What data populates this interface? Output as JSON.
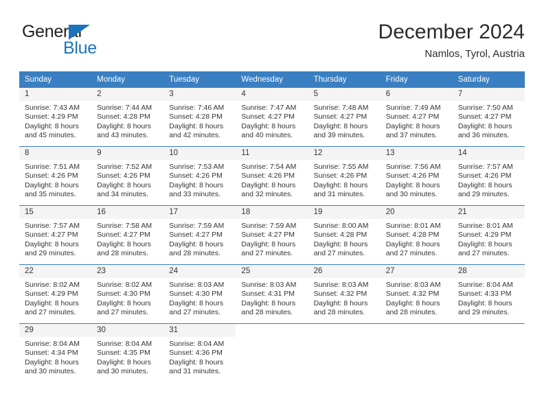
{
  "logo": {
    "primary_text": "General",
    "secondary_text": "Blue",
    "primary_color": "#231f20",
    "accent_color": "#1b74bd",
    "triangle_icon": "blue-triangle-icon"
  },
  "header": {
    "title": "December 2024",
    "subtitle": "Namlos, Tyrol, Austria"
  },
  "theme": {
    "header_bg": "#3a7fc1",
    "header_text": "#ffffff",
    "daynum_bg": "#f4f4f4",
    "cell_bg": "#ffffff",
    "text": "#333333",
    "grid_line": "#3a7fc1"
  },
  "weekday_headers": [
    "Sunday",
    "Monday",
    "Tuesday",
    "Wednesday",
    "Thursday",
    "Friday",
    "Saturday"
  ],
  "weeks": [
    [
      {
        "day": "1",
        "sunrise": "Sunrise: 7:43 AM",
        "sunset": "Sunset: 4:29 PM",
        "daylight_line1": "Daylight: 8 hours",
        "daylight_line2": "and 45 minutes."
      },
      {
        "day": "2",
        "sunrise": "Sunrise: 7:44 AM",
        "sunset": "Sunset: 4:28 PM",
        "daylight_line1": "Daylight: 8 hours",
        "daylight_line2": "and 43 minutes."
      },
      {
        "day": "3",
        "sunrise": "Sunrise: 7:46 AM",
        "sunset": "Sunset: 4:28 PM",
        "daylight_line1": "Daylight: 8 hours",
        "daylight_line2": "and 42 minutes."
      },
      {
        "day": "4",
        "sunrise": "Sunrise: 7:47 AM",
        "sunset": "Sunset: 4:27 PM",
        "daylight_line1": "Daylight: 8 hours",
        "daylight_line2": "and 40 minutes."
      },
      {
        "day": "5",
        "sunrise": "Sunrise: 7:48 AM",
        "sunset": "Sunset: 4:27 PM",
        "daylight_line1": "Daylight: 8 hours",
        "daylight_line2": "and 39 minutes."
      },
      {
        "day": "6",
        "sunrise": "Sunrise: 7:49 AM",
        "sunset": "Sunset: 4:27 PM",
        "daylight_line1": "Daylight: 8 hours",
        "daylight_line2": "and 37 minutes."
      },
      {
        "day": "7",
        "sunrise": "Sunrise: 7:50 AM",
        "sunset": "Sunset: 4:27 PM",
        "daylight_line1": "Daylight: 8 hours",
        "daylight_line2": "and 36 minutes."
      }
    ],
    [
      {
        "day": "8",
        "sunrise": "Sunrise: 7:51 AM",
        "sunset": "Sunset: 4:26 PM",
        "daylight_line1": "Daylight: 8 hours",
        "daylight_line2": "and 35 minutes."
      },
      {
        "day": "9",
        "sunrise": "Sunrise: 7:52 AM",
        "sunset": "Sunset: 4:26 PM",
        "daylight_line1": "Daylight: 8 hours",
        "daylight_line2": "and 34 minutes."
      },
      {
        "day": "10",
        "sunrise": "Sunrise: 7:53 AM",
        "sunset": "Sunset: 4:26 PM",
        "daylight_line1": "Daylight: 8 hours",
        "daylight_line2": "and 33 minutes."
      },
      {
        "day": "11",
        "sunrise": "Sunrise: 7:54 AM",
        "sunset": "Sunset: 4:26 PM",
        "daylight_line1": "Daylight: 8 hours",
        "daylight_line2": "and 32 minutes."
      },
      {
        "day": "12",
        "sunrise": "Sunrise: 7:55 AM",
        "sunset": "Sunset: 4:26 PM",
        "daylight_line1": "Daylight: 8 hours",
        "daylight_line2": "and 31 minutes."
      },
      {
        "day": "13",
        "sunrise": "Sunrise: 7:56 AM",
        "sunset": "Sunset: 4:26 PM",
        "daylight_line1": "Daylight: 8 hours",
        "daylight_line2": "and 30 minutes."
      },
      {
        "day": "14",
        "sunrise": "Sunrise: 7:57 AM",
        "sunset": "Sunset: 4:26 PM",
        "daylight_line1": "Daylight: 8 hours",
        "daylight_line2": "and 29 minutes."
      }
    ],
    [
      {
        "day": "15",
        "sunrise": "Sunrise: 7:57 AM",
        "sunset": "Sunset: 4:27 PM",
        "daylight_line1": "Daylight: 8 hours",
        "daylight_line2": "and 29 minutes."
      },
      {
        "day": "16",
        "sunrise": "Sunrise: 7:58 AM",
        "sunset": "Sunset: 4:27 PM",
        "daylight_line1": "Daylight: 8 hours",
        "daylight_line2": "and 28 minutes."
      },
      {
        "day": "17",
        "sunrise": "Sunrise: 7:59 AM",
        "sunset": "Sunset: 4:27 PM",
        "daylight_line1": "Daylight: 8 hours",
        "daylight_line2": "and 28 minutes."
      },
      {
        "day": "18",
        "sunrise": "Sunrise: 7:59 AM",
        "sunset": "Sunset: 4:27 PM",
        "daylight_line1": "Daylight: 8 hours",
        "daylight_line2": "and 27 minutes."
      },
      {
        "day": "19",
        "sunrise": "Sunrise: 8:00 AM",
        "sunset": "Sunset: 4:28 PM",
        "daylight_line1": "Daylight: 8 hours",
        "daylight_line2": "and 27 minutes."
      },
      {
        "day": "20",
        "sunrise": "Sunrise: 8:01 AM",
        "sunset": "Sunset: 4:28 PM",
        "daylight_line1": "Daylight: 8 hours",
        "daylight_line2": "and 27 minutes."
      },
      {
        "day": "21",
        "sunrise": "Sunrise: 8:01 AM",
        "sunset": "Sunset: 4:29 PM",
        "daylight_line1": "Daylight: 8 hours",
        "daylight_line2": "and 27 minutes."
      }
    ],
    [
      {
        "day": "22",
        "sunrise": "Sunrise: 8:02 AM",
        "sunset": "Sunset: 4:29 PM",
        "daylight_line1": "Daylight: 8 hours",
        "daylight_line2": "and 27 minutes."
      },
      {
        "day": "23",
        "sunrise": "Sunrise: 8:02 AM",
        "sunset": "Sunset: 4:30 PM",
        "daylight_line1": "Daylight: 8 hours",
        "daylight_line2": "and 27 minutes."
      },
      {
        "day": "24",
        "sunrise": "Sunrise: 8:03 AM",
        "sunset": "Sunset: 4:30 PM",
        "daylight_line1": "Daylight: 8 hours",
        "daylight_line2": "and 27 minutes."
      },
      {
        "day": "25",
        "sunrise": "Sunrise: 8:03 AM",
        "sunset": "Sunset: 4:31 PM",
        "daylight_line1": "Daylight: 8 hours",
        "daylight_line2": "and 28 minutes."
      },
      {
        "day": "26",
        "sunrise": "Sunrise: 8:03 AM",
        "sunset": "Sunset: 4:32 PM",
        "daylight_line1": "Daylight: 8 hours",
        "daylight_line2": "and 28 minutes."
      },
      {
        "day": "27",
        "sunrise": "Sunrise: 8:03 AM",
        "sunset": "Sunset: 4:32 PM",
        "daylight_line1": "Daylight: 8 hours",
        "daylight_line2": "and 28 minutes."
      },
      {
        "day": "28",
        "sunrise": "Sunrise: 8:04 AM",
        "sunset": "Sunset: 4:33 PM",
        "daylight_line1": "Daylight: 8 hours",
        "daylight_line2": "and 29 minutes."
      }
    ],
    [
      {
        "day": "29",
        "sunrise": "Sunrise: 8:04 AM",
        "sunset": "Sunset: 4:34 PM",
        "daylight_line1": "Daylight: 8 hours",
        "daylight_line2": "and 30 minutes."
      },
      {
        "day": "30",
        "sunrise": "Sunrise: 8:04 AM",
        "sunset": "Sunset: 4:35 PM",
        "daylight_line1": "Daylight: 8 hours",
        "daylight_line2": "and 30 minutes."
      },
      {
        "day": "31",
        "sunrise": "Sunrise: 8:04 AM",
        "sunset": "Sunset: 4:36 PM",
        "daylight_line1": "Daylight: 8 hours",
        "daylight_line2": "and 31 minutes."
      },
      {
        "day": "",
        "sunrise": "",
        "sunset": "",
        "daylight_line1": "",
        "daylight_line2": ""
      },
      {
        "day": "",
        "sunrise": "",
        "sunset": "",
        "daylight_line1": "",
        "daylight_line2": ""
      },
      {
        "day": "",
        "sunrise": "",
        "sunset": "",
        "daylight_line1": "",
        "daylight_line2": ""
      },
      {
        "day": "",
        "sunrise": "",
        "sunset": "",
        "daylight_line1": "",
        "daylight_line2": ""
      }
    ]
  ]
}
